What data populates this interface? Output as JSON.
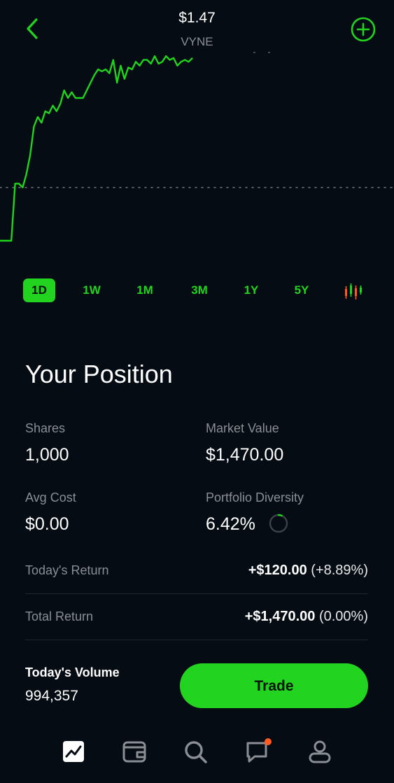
{
  "header": {
    "price": "$1.47",
    "ticker": "VYNE",
    "back_icon": "chevron-left-icon",
    "add_icon": "plus-circle-icon"
  },
  "chart_data": {
    "type": "line",
    "title": "",
    "xlabel": "",
    "ylabel": "",
    "series": [
      {
        "values": [
          0.0,
          0.0,
          0.0,
          0.0,
          0.3,
          0.3,
          0.28,
          0.35,
          0.45,
          0.6,
          0.65,
          0.62,
          0.68,
          0.67,
          0.71,
          0.68,
          0.72,
          0.79,
          0.75,
          0.78,
          0.75,
          0.75,
          0.75,
          0.79,
          0.83,
          0.87,
          0.9,
          0.89,
          0.9,
          0.88,
          0.95,
          0.83,
          0.92,
          0.85,
          0.91,
          0.9,
          0.94,
          0.92,
          0.95,
          0.95,
          0.93,
          0.97,
          0.93,
          0.94,
          0.97,
          0.95,
          0.96,
          0.92,
          0.94,
          0.95,
          0.94,
          0.96
        ]
      }
    ],
    "reference_line": "previous close (dotted)",
    "color": "#22d320"
  },
  "ranges": {
    "items": [
      {
        "label": "1D",
        "active": true
      },
      {
        "label": "1W",
        "active": false
      },
      {
        "label": "1M",
        "active": false
      },
      {
        "label": "3M",
        "active": false
      },
      {
        "label": "1Y",
        "active": false
      },
      {
        "label": "5Y",
        "active": false
      }
    ],
    "candle_icon": "candlestick-chart-icon"
  },
  "position": {
    "title": "Your Position",
    "shares_label": "Shares",
    "shares_value": "1,000",
    "market_value_label": "Market Value",
    "market_value": "$1,470.00",
    "avg_cost_label": "Avg Cost",
    "avg_cost_value": "$0.00",
    "diversity_label": "Portfolio Diversity",
    "diversity_value": "6.42%",
    "diversity_fraction": 0.0642,
    "todays_return_label": "Today's Return",
    "todays_return_value": "+$120.00",
    "todays_return_pct": "(+8.89%)",
    "total_return_label": "Total Return",
    "total_return_value": "+$1,470.00",
    "total_return_pct": "(0.00%)"
  },
  "volume": {
    "label": "Today's Volume",
    "value": "994,357"
  },
  "trade": {
    "label": "Trade"
  },
  "tabbar": {
    "items": [
      {
        "icon": "chart-icon",
        "active": true
      },
      {
        "icon": "wallet-icon",
        "active": false
      },
      {
        "icon": "search-icon",
        "active": false
      },
      {
        "icon": "chat-icon",
        "active": false,
        "badge": true
      },
      {
        "icon": "account-icon",
        "active": false
      }
    ]
  },
  "colors": {
    "background": "#050c13",
    "accent": "#22d320",
    "badge": "#ff5a1f",
    "muted": "#8b8f95"
  }
}
